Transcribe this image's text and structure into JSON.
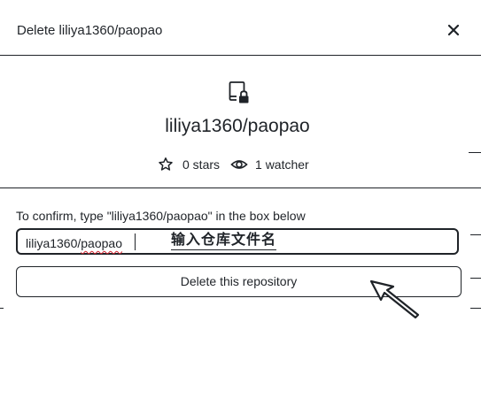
{
  "dialog": {
    "title": "Delete liliya1360/paopao",
    "close_icon": "x-close-icon"
  },
  "repo": {
    "icon": "repo-locked-icon",
    "name": "liliya1360/paopao",
    "stars_label": "0 stars",
    "watchers_label": "1 watcher",
    "star_icon": "star-icon",
    "eye_icon": "eye-icon"
  },
  "confirm": {
    "label": "To confirm, type \"liliya1360/paopao\" in the box below",
    "input_value_plain": "liliya1360/",
    "input_value_flagged": "paopao"
  },
  "annotation": {
    "text": "输入仓库文件名",
    "arrow_icon": "pointer-arrow-icon"
  },
  "actions": {
    "delete_label": "Delete this repository"
  }
}
